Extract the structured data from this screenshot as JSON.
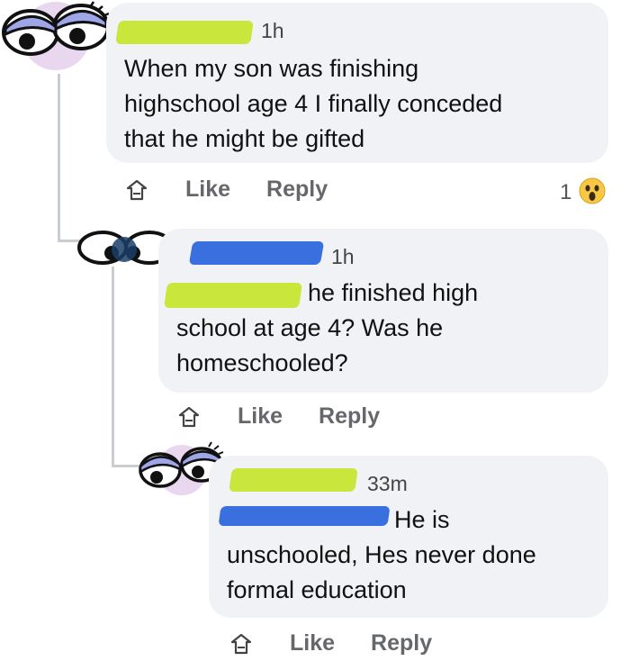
{
  "comments": [
    {
      "time": "1h",
      "text": "When my son was finishing\nhighschool age 4 I finally conceded\nthat he might be gifted",
      "like_label": "Like",
      "reply_label": "Reply",
      "reaction_count": "1",
      "reaction_icon": "wow-emoji-icon"
    },
    {
      "time": "1h",
      "text_line1": "he finished high",
      "text_rest": "school at age 4? Was he\nhomeschooled?",
      "like_label": "Like",
      "reply_label": "Reply"
    },
    {
      "time": "33m",
      "text_line1": "He is",
      "text_rest": "unschooled, Hes never done\nformal education",
      "like_label": "Like",
      "reply_label": "Reply"
    }
  ],
  "colors": {
    "bubble": "#f0f2f5",
    "redact_yellow": "#c8e63c",
    "redact_blue": "#3a6fe0",
    "action_gray": "#65676b"
  }
}
